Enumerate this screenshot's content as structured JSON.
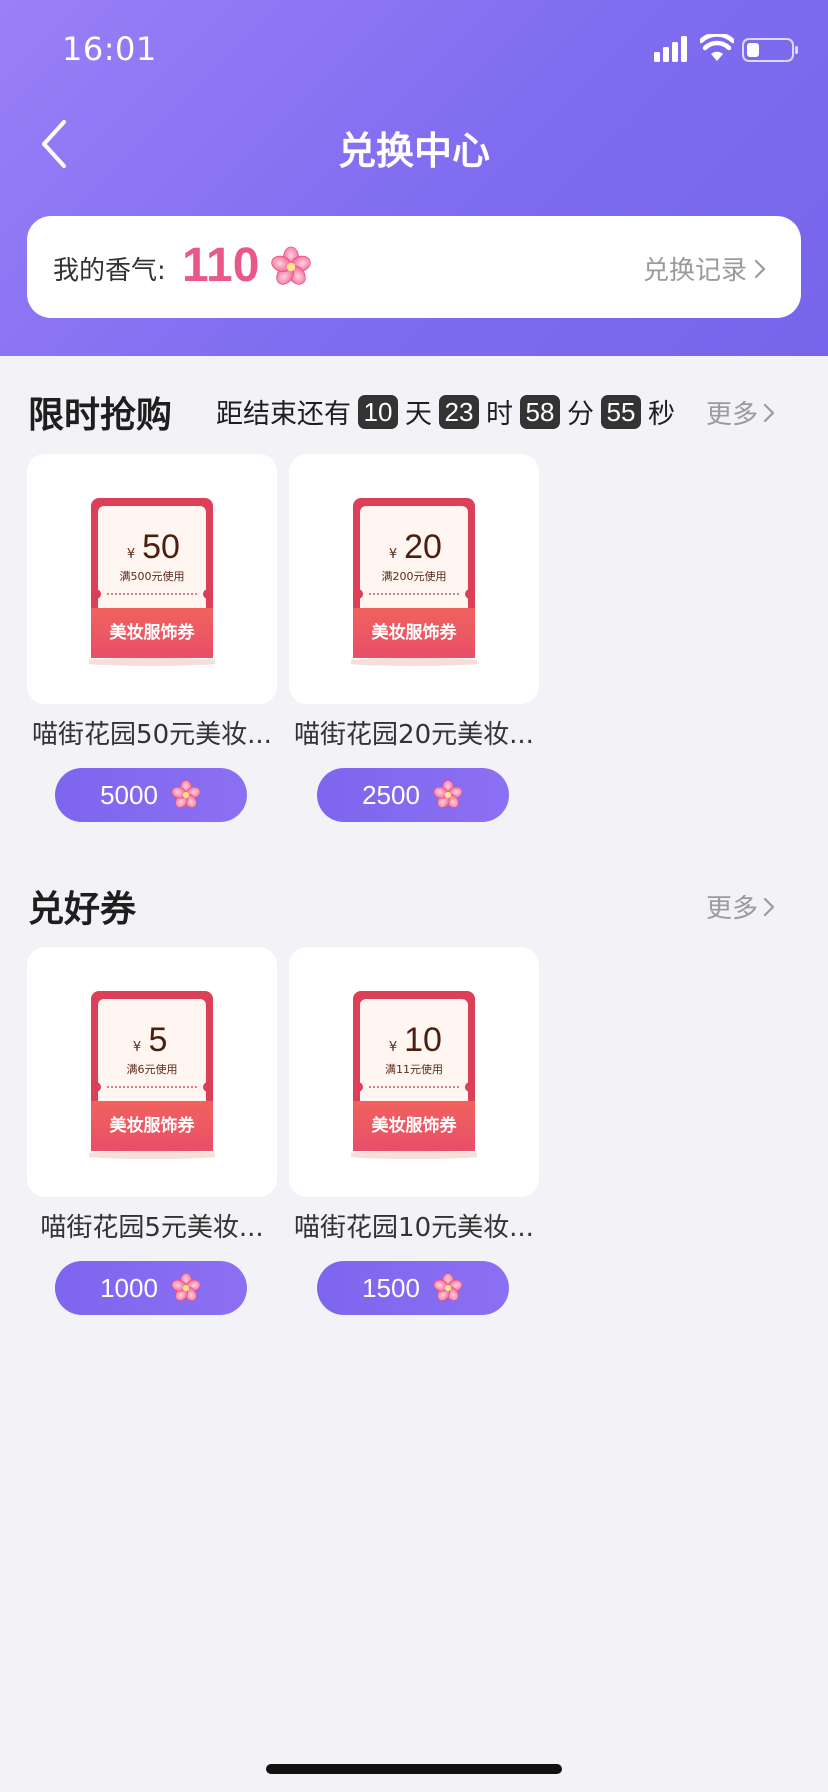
{
  "status_bar": {
    "time": "16:01"
  },
  "nav": {
    "title": "兑换中心"
  },
  "points": {
    "label": "我的香气:",
    "value": "110",
    "record_link": "兑换记录"
  },
  "flash_sale": {
    "title": "限时抢购",
    "countdown_prefix": "距结束还有",
    "days": "10",
    "days_unit": "天",
    "hours": "23",
    "hours_unit": "时",
    "minutes": "58",
    "minutes_unit": "分",
    "seconds": "55",
    "seconds_unit": "秒",
    "more": "更多",
    "items": [
      {
        "name": "喵街花园50元美妆...",
        "price": "5000",
        "coupon": {
          "currency": "¥",
          "amount": "50",
          "condition": "满500元使用",
          "label": "美妆服饰券"
        }
      },
      {
        "name": "喵街花园20元美妆...",
        "price": "2500",
        "coupon": {
          "currency": "¥",
          "amount": "20",
          "condition": "满200元使用",
          "label": "美妆服饰券"
        }
      }
    ]
  },
  "good_coupons": {
    "title": "兑好券",
    "more": "更多",
    "items": [
      {
        "name": "喵街花园5元美妆...",
        "price": "1000",
        "coupon": {
          "currency": "¥",
          "amount": "5",
          "condition": "满6元使用",
          "label": "美妆服饰券"
        }
      },
      {
        "name": "喵街花园10元美妆...",
        "price": "1500",
        "coupon": {
          "currency": "¥",
          "amount": "10",
          "condition": "满11元使用",
          "label": "美妆服饰券"
        }
      }
    ]
  },
  "colors": {
    "header_start": "#9a80f7",
    "header_end": "#7665ea",
    "accent_pink": "#e9578c",
    "button_purple": "#7d65ee",
    "coupon_red": "#dc3f58"
  },
  "icons": {
    "back": "chevron-left-icon",
    "flower": "flower-icon",
    "arrow": "chevron-right-icon"
  }
}
